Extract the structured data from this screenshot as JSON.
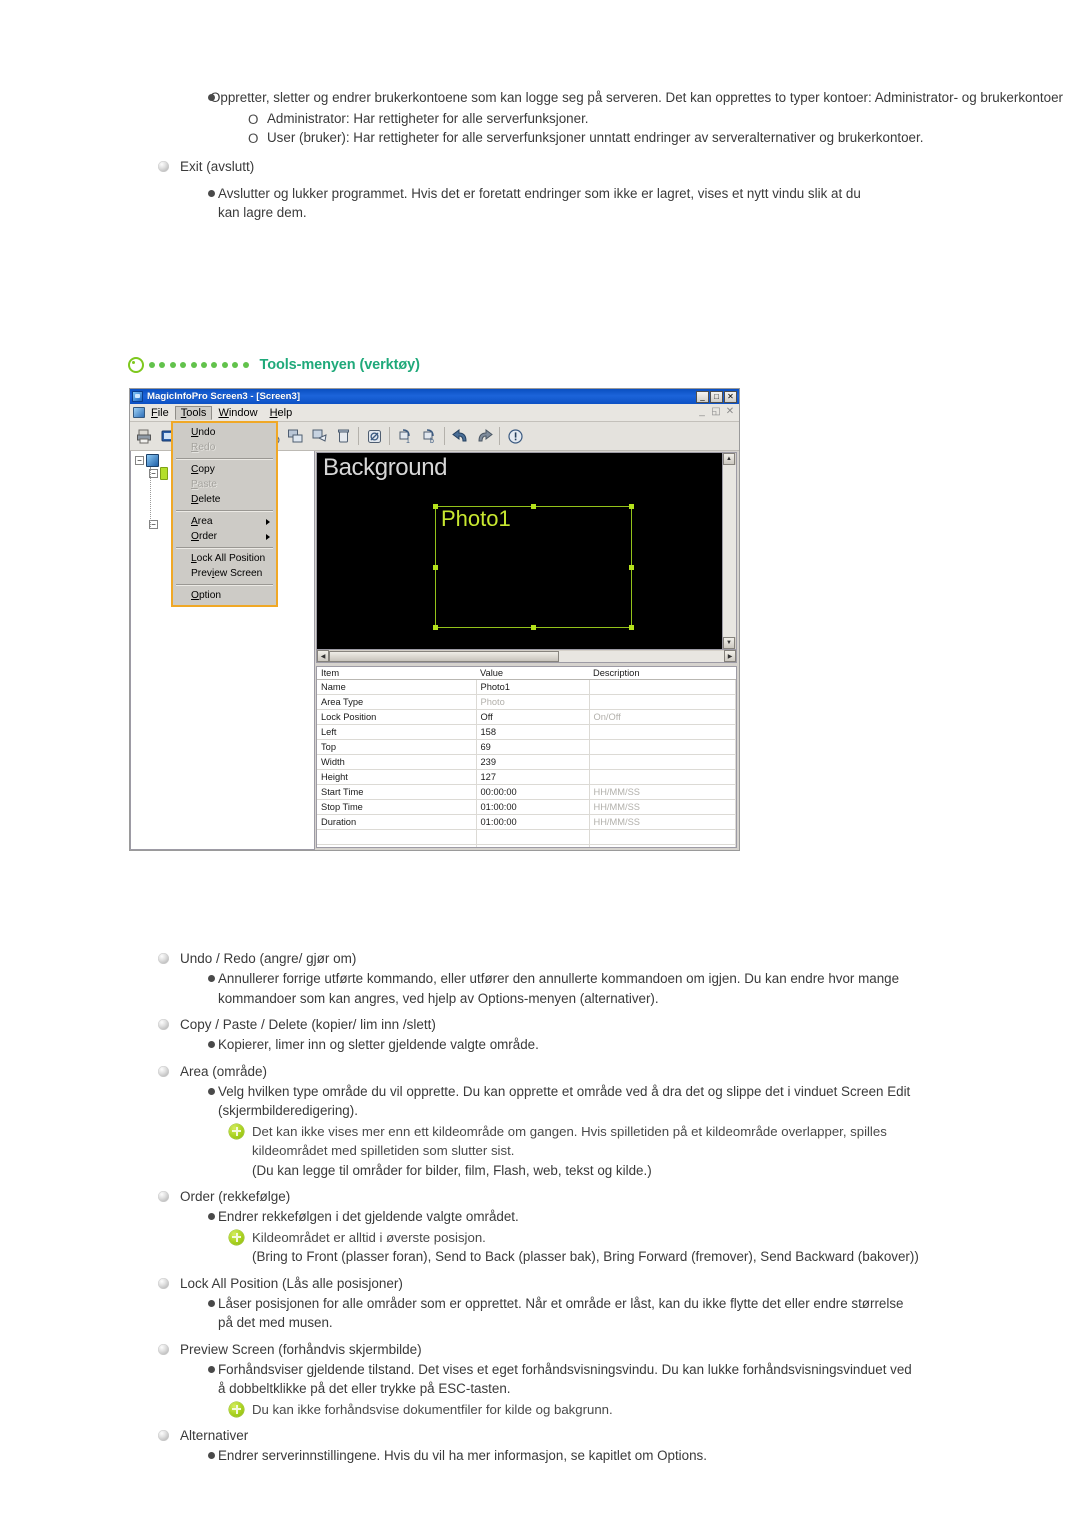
{
  "doc": {
    "top_section": {
      "b1": "Oppretter, sletter og endrer brukerkontoene som kan logge seg på serveren. Det kan opprettes to typer kontoer: Administrator- og brukerkontoer",
      "b1_sub1": "Administrator: Har rettigheter for alle serverfunksjoner.",
      "b1_sub2": "User (bruker): Har rettigheter for alle serverfunksjoner unntatt endringer av serveralternativer og brukerkontoer.",
      "exit_heading": "Exit (avslutt)",
      "exit_body": "Avslutter og lukker programmet. Hvis det er foretatt endringer som ikke er lagret, vises et nytt vindu slik at du kan lagre dem."
    },
    "section_header": {
      "title": "Tools-menyen (verktøy)",
      "ring_icon": "ring-icon",
      "dot_count": 10,
      "accent_color": "#1fa97a",
      "dot_color": "#62c24b"
    },
    "bottom_section": [
      {
        "heading": "Undo / Redo (angre/ gjør om)",
        "items": [
          {
            "type": "bullet",
            "text": "Annullerer forrige utførte kommando, eller utfører den annullerte kommandoen om igjen. Du kan endre hvor mange kommandoer som kan angres, ved hjelp av Options-menyen (alternativer)."
          }
        ]
      },
      {
        "heading": "Copy / Paste / Delete (kopier/ lim inn /slett)",
        "items": [
          {
            "type": "bullet",
            "text": "Kopierer, limer inn og sletter gjeldende valgte område."
          }
        ]
      },
      {
        "heading": "Area (område)",
        "items": [
          {
            "type": "bullet",
            "text": "Velg hvilken type område du vil opprette. Du kan opprette et område ved å dra det og slippe det i vinduet Screen Edit (skjermbilderedigering)."
          },
          {
            "type": "note",
            "text": "Det kan ikke vises mer enn ett kildeområde om gangen. Hvis spilletiden på et kildeområde overlapper, spilles kildeområdet med spilletiden som slutter sist."
          },
          {
            "type": "cont",
            "text": "(Du kan legge til områder for bilder, film, Flash, web, tekst og kilde.)"
          }
        ]
      },
      {
        "heading": "Order (rekkefølge)",
        "items": [
          {
            "type": "bullet",
            "text": "Endrer rekkefølgen i det gjeldende valgte området."
          },
          {
            "type": "note",
            "text": "Kildeområdet er alltid i øverste posisjon."
          },
          {
            "type": "cont",
            "text": "(Bring to Front (plasser foran), Send to Back (plasser bak), Bring Forward (fremover), Send Backward (bakover))"
          }
        ]
      },
      {
        "heading": "Lock All Position (Lås alle posisjoner)",
        "items": [
          {
            "type": "bullet",
            "text": "Låser posisjonen for alle områder som er opprettet. Når et område er låst, kan du ikke flytte det eller endre størrelse på det med musen."
          }
        ]
      },
      {
        "heading": "Preview Screen (forhåndvis skjermbilde)",
        "items": [
          {
            "type": "bullet",
            "text": "Forhåndsviser gjeldende tilstand. Det vises et eget forhåndsvisningsvindu. Du kan lukke forhåndsvisningsvinduet ved å dobbeltklikke på det eller trykke på ESC-tasten."
          },
          {
            "type": "note",
            "text": "Du kan ikke forhåndsvise dokumentfiler for kilde og bakgrunn."
          }
        ]
      },
      {
        "heading": "Alternativer",
        "items": [
          {
            "type": "bullet",
            "text": "Endrer serverinnstillingene. Hvis du vil ha mer informasjon, se kapitlet om Options."
          }
        ]
      }
    ]
  },
  "app": {
    "titlebar": {
      "title": "MagicInfoPro Screen3 - [Screen3]",
      "minimize": "_",
      "maximize": "□",
      "close": "✕"
    },
    "menubar": {
      "items": [
        "File",
        "Tools",
        "Window",
        "Help"
      ],
      "active": "Tools",
      "mdi_minimize": "_",
      "mdi_restore": "◱",
      "mdi_close": "✕"
    },
    "toolbar": {
      "icons": [
        "print-icon",
        "new-screen-icon",
        "open-folder-icon",
        "save-icon",
        "preview-eye-icon",
        "add-area-icon",
        "copy-area-icon",
        "paste-area-icon",
        "delete-icon",
        "link-icon",
        "bring-front-icon",
        "send-back-icon",
        "undo-icon",
        "redo-icon",
        "info-icon"
      ]
    },
    "tools_menu": {
      "items": [
        {
          "label": "Undo",
          "accel": "U",
          "disabled": false,
          "submenu": false,
          "sep_after": false
        },
        {
          "label": "Redo",
          "accel": "R",
          "disabled": true,
          "submenu": false,
          "sep_after": true
        },
        {
          "label": "Copy",
          "accel": "C",
          "disabled": false,
          "submenu": false,
          "sep_after": false
        },
        {
          "label": "Paste",
          "accel": "P",
          "disabled": true,
          "submenu": false,
          "sep_after": false
        },
        {
          "label": "Delete",
          "accel": "D",
          "disabled": false,
          "submenu": false,
          "sep_after": true
        },
        {
          "label": "Area",
          "accel": "A",
          "disabled": false,
          "submenu": true,
          "sep_after": false
        },
        {
          "label": "Order",
          "accel": "O",
          "disabled": false,
          "submenu": true,
          "sep_after": true
        },
        {
          "label": "Lock All Position",
          "accel": "L",
          "disabled": false,
          "submenu": false,
          "sep_after": false
        },
        {
          "label": "Preview Screen",
          "accel": "i",
          "disabled": false,
          "submenu": false,
          "sep_after": true
        },
        {
          "label": "Option",
          "accel": "O",
          "disabled": false,
          "submenu": false,
          "sep_after": false
        }
      ],
      "highlight_border_color": "#f0a826"
    },
    "canvas": {
      "background_label": "Background",
      "area_label": "Photo1",
      "selection_color": "#93c21a",
      "bg_color": "#000000"
    },
    "properties": {
      "columns": [
        "Item",
        "Value",
        "Description"
      ],
      "rows": [
        {
          "item": "Name",
          "value": "Photo1",
          "value_dim": false,
          "desc": "",
          "desc_dim": false
        },
        {
          "item": "Area Type",
          "value": "Photo",
          "value_dim": true,
          "desc": "",
          "desc_dim": false
        },
        {
          "item": "Lock Position",
          "value": "Off",
          "value_dim": false,
          "desc": "On/Off",
          "desc_dim": true
        },
        {
          "item": "Left",
          "value": "158",
          "value_dim": false,
          "desc": "",
          "desc_dim": false
        },
        {
          "item": "Top",
          "value": "69",
          "value_dim": false,
          "desc": "",
          "desc_dim": false
        },
        {
          "item": "Width",
          "value": "239",
          "value_dim": false,
          "desc": "",
          "desc_dim": false
        },
        {
          "item": "Height",
          "value": "127",
          "value_dim": false,
          "desc": "",
          "desc_dim": false
        },
        {
          "item": "Start Time",
          "value": "00:00:00",
          "value_dim": false,
          "desc": "HH/MM/SS",
          "desc_dim": true
        },
        {
          "item": "Stop Time",
          "value": "01:00:00",
          "value_dim": false,
          "desc": "HH/MM/SS",
          "desc_dim": true
        },
        {
          "item": "Duration",
          "value": "01:00:00",
          "value_dim": false,
          "desc": "HH/MM/SS",
          "desc_dim": true
        },
        {
          "item": "",
          "value": "",
          "value_dim": false,
          "desc": "",
          "desc_dim": false
        },
        {
          "item": "",
          "value": "",
          "value_dim": false,
          "desc": "",
          "desc_dim": false
        },
        {
          "item": "",
          "value": "",
          "value_dim": false,
          "desc": "",
          "desc_dim": false
        }
      ]
    },
    "scrollbars": {
      "left_arrow": "◀",
      "right_arrow": "▶",
      "up_arrow": "▲",
      "down_arrow": "▼"
    }
  }
}
